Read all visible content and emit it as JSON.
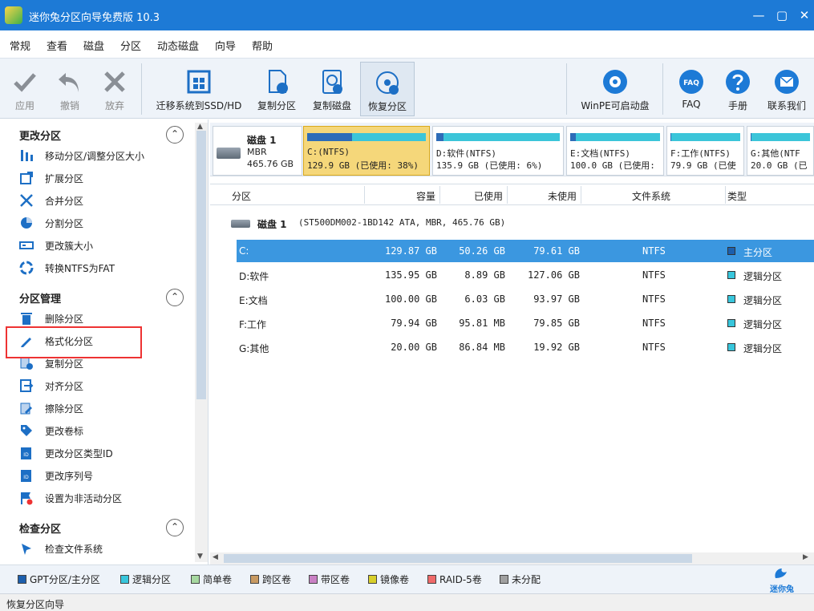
{
  "window": {
    "title": "迷你兔分区向导免费版 10.3"
  },
  "menu": [
    "常规",
    "查看",
    "磁盘",
    "分区",
    "动态磁盘",
    "向导",
    "帮助"
  ],
  "toolbar": {
    "apply": "应用",
    "undo": "撤销",
    "discard": "放弃",
    "migrate": "迁移系统到SSD/HD",
    "copy_partition": "复制分区",
    "copy_disk": "复制磁盘",
    "recover_partition": "恢复分区",
    "winpe": "WinPE可启动盘",
    "faq": "FAQ",
    "manual": "手册",
    "contact": "联系我们",
    "faq_badge": "FAQ"
  },
  "sidebar": {
    "sections": [
      "更改分区",
      "分区管理",
      "检查分区"
    ],
    "change_ops": [
      "移动分区/调整分区大小",
      "扩展分区",
      "合并分区",
      "分割分区",
      "更改簇大小",
      "转换NTFS为FAT"
    ],
    "manage_ops": [
      "删除分区",
      "格式化分区",
      "复制分区",
      "对齐分区",
      "擦除分区",
      "更改卷标",
      "更改分区类型ID",
      "更改序列号",
      "设置为非活动分区"
    ],
    "check_ops": [
      "检查文件系统"
    ]
  },
  "diskmap": {
    "disk_label": "磁盘 1",
    "disk_type": "MBR",
    "disk_size": "465.76 GB",
    "partitions": [
      {
        "name": "C:(NTFS)",
        "detail": "129.9 GB (已使用: 38%)",
        "used_fraction": 0.38
      },
      {
        "name": "D:软件(NTFS)",
        "detail": "135.9 GB (已使用: 6%)",
        "used_fraction": 0.06
      },
      {
        "name": "E:文档(NTFS)",
        "detail": "100.0 GB (已使用:",
        "used_fraction": 0.06
      },
      {
        "name": "F:工作(NTFS)",
        "detail": "79.9 GB (已使",
        "used_fraction": 0.01
      },
      {
        "name": "G:其他(NTF",
        "detail": "20.0 GB (已",
        "used_fraction": 0.01
      }
    ]
  },
  "table": {
    "headers": [
      "分区",
      "容量",
      "已使用",
      "未使用",
      "文件系统",
      "类型"
    ],
    "disk_row": {
      "name": "磁盘 1",
      "detail": "(ST500DM002-1BD142 ATA, MBR, 465.76 GB)"
    },
    "rows": [
      {
        "name": "C:",
        "capacity": "129.87 GB",
        "used": "50.26 GB",
        "unused": "79.61 GB",
        "fs": "NTFS",
        "type": "主分区",
        "color": "#1c5fad"
      },
      {
        "name": "D:软件",
        "capacity": "135.95 GB",
        "used": "8.89 GB",
        "unused": "127.06 GB",
        "fs": "NTFS",
        "type": "逻辑分区",
        "color": "#38c6dc"
      },
      {
        "name": "E:文档",
        "capacity": "100.00 GB",
        "used": "6.03 GB",
        "unused": "93.97 GB",
        "fs": "NTFS",
        "type": "逻辑分区",
        "color": "#38c6dc"
      },
      {
        "name": "F:工作",
        "capacity": "79.94 GB",
        "used": "95.81 MB",
        "unused": "79.85 GB",
        "fs": "NTFS",
        "type": "逻辑分区",
        "color": "#38c6dc"
      },
      {
        "name": "G:其他",
        "capacity": "20.00 GB",
        "used": "86.84 MB",
        "unused": "19.92 GB",
        "fs": "NTFS",
        "type": "逻辑分区",
        "color": "#38c6dc"
      }
    ]
  },
  "legend": [
    {
      "label": "GPT分区/主分区",
      "color": "#1c5fad"
    },
    {
      "label": "逻辑分区",
      "color": "#38c6dc"
    },
    {
      "label": "简单卷",
      "color": "#a6d8a0"
    },
    {
      "label": "跨区卷",
      "color": "#c89a62"
    },
    {
      "label": "带区卷",
      "color": "#c980c4"
    },
    {
      "label": "镜像卷",
      "color": "#d8cf2a"
    },
    {
      "label": "RAID-5卷",
      "color": "#ef6a6a"
    },
    {
      "label": "未分配",
      "color": "#a0a0a0"
    }
  ],
  "brand": "迷你兔",
  "status": "恢复分区向导"
}
